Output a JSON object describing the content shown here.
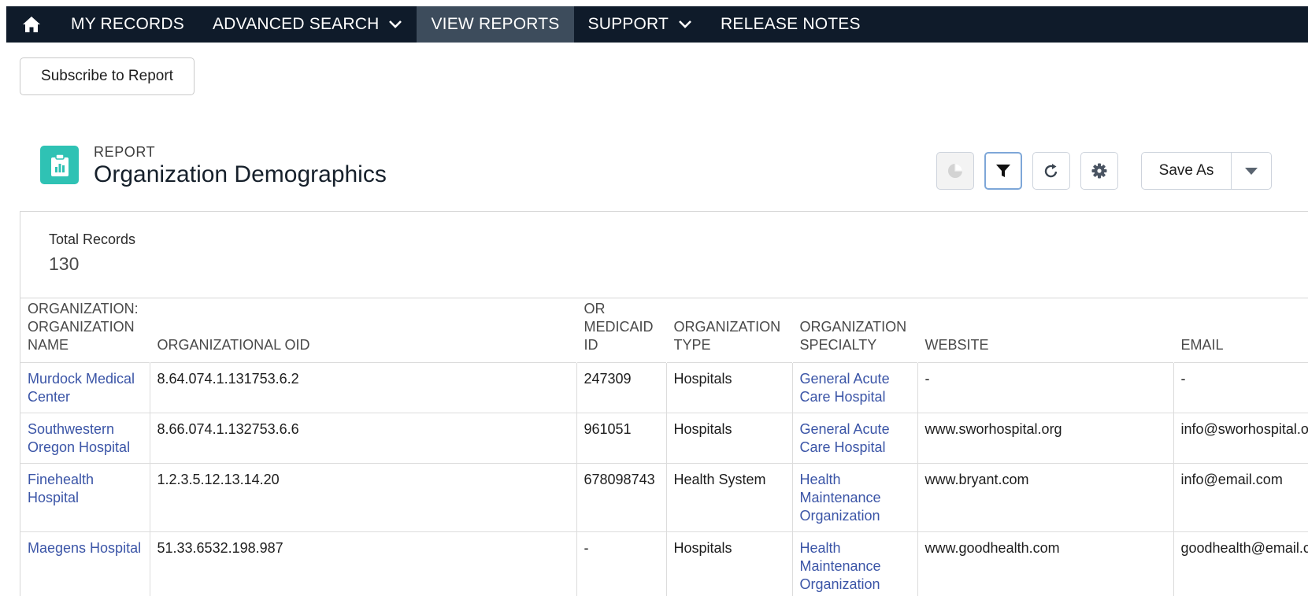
{
  "nav": {
    "items": [
      {
        "label": "MY RECORDS"
      },
      {
        "label": "ADVANCED SEARCH"
      },
      {
        "label": "VIEW REPORTS"
      },
      {
        "label": "SUPPORT"
      },
      {
        "label": "RELEASE NOTES"
      }
    ],
    "active": "VIEW REPORTS"
  },
  "subscribe_label": "Subscribe to Report",
  "report": {
    "kicker": "REPORT",
    "title": "Organization Demographics"
  },
  "toolbar": {
    "save_as_label": "Save As",
    "icons": [
      "chart-icon",
      "filter-icon",
      "refresh-icon",
      "gear-icon",
      "chevron-down-icon"
    ]
  },
  "summary": {
    "label": "Total Records",
    "value": "130"
  },
  "table": {
    "columns": [
      "ORGANIZATION: ORGANIZATION NAME",
      "ORGANIZATIONAL OID",
      "OR MEDICAID ID",
      "ORGANIZATION TYPE",
      "ORGANIZATION SPECIALTY",
      "WEBSITE",
      "EMAIL"
    ],
    "rows": [
      [
        "Murdock Medical Center",
        "8.64.074.1.131753.6.2",
        "247309",
        "Hospitals",
        "General Acute Care Hospital",
        "-",
        "-"
      ],
      [
        "Southwestern Oregon Hospital",
        "8.66.074.1.132753.6.6",
        "961051",
        "Hospitals",
        "General Acute Care Hospital",
        "www.sworhospital.org",
        "info@sworhospital.org"
      ],
      [
        "Finehealth Hospital",
        "1.2.3.5.12.13.14.20",
        "678098743",
        "Health System",
        "Health Maintenance Organization",
        "www.bryant.com",
        "info@email.com"
      ],
      [
        "Maegens Hospital",
        "51.33.6532.198.987",
        "-",
        "Hospitals",
        "Health Maintenance Organization",
        "www.goodhealth.com",
        "goodhealth@email.com"
      ]
    ]
  },
  "colors": {
    "nav_bg": "#0f1b2a",
    "nav_active": "#3d4c5c",
    "report_icon": "#2fc2b4",
    "link": "#3b55a7"
  }
}
